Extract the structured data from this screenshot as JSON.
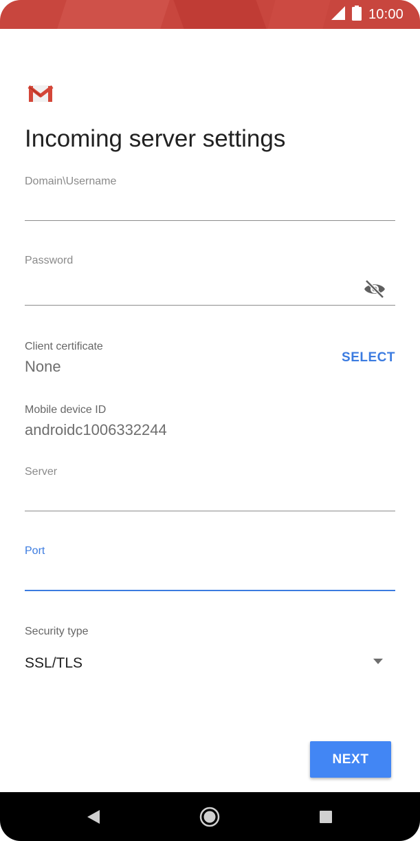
{
  "status_bar": {
    "time": "10:00",
    "background_color": "#c8463e"
  },
  "app": {
    "logo_icon": "gmail-logo-icon"
  },
  "page": {
    "title": "Incoming server settings"
  },
  "form": {
    "domain_username": {
      "label": "Domain\\Username",
      "value": ""
    },
    "password": {
      "label": "Password",
      "value": "",
      "toggle_icon": "visibility-off-icon"
    },
    "client_certificate": {
      "label": "Client certificate",
      "value": "None",
      "action_label": "SELECT"
    },
    "mobile_device_id": {
      "label": "Mobile device ID",
      "value": "androidc1006332244"
    },
    "server": {
      "label": "Server",
      "value": ""
    },
    "port": {
      "label": "Port",
      "value": "",
      "focused": true
    },
    "security_type": {
      "label": "Security type",
      "selected": "SSL/TLS"
    }
  },
  "actions": {
    "next_label": "NEXT"
  },
  "colors": {
    "accent": "#4286f4",
    "focus": "#3b7be0",
    "header": "#c8463e"
  },
  "nav_bar": {
    "back_icon": "back-triangle-icon",
    "home_icon": "home-circle-icon",
    "recents_icon": "recents-square-icon"
  }
}
